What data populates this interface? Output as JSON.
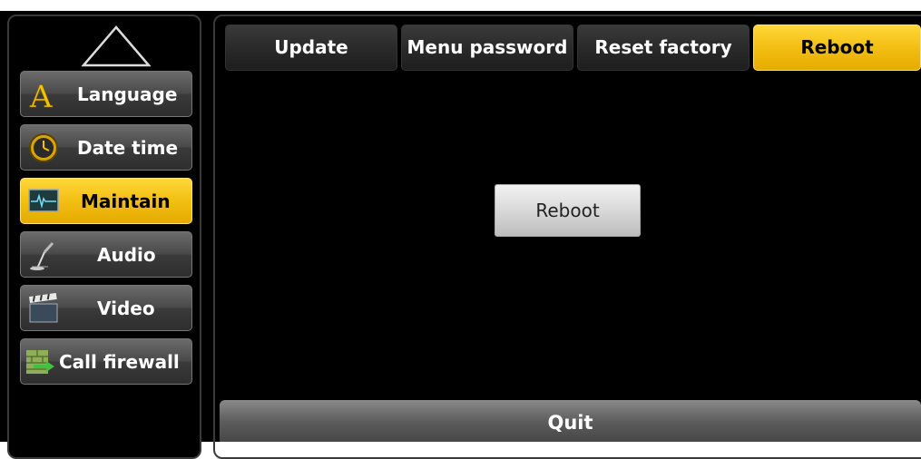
{
  "sidebar": {
    "items": [
      {
        "label": "Language",
        "icon": "letter-a-icon"
      },
      {
        "label": "Date time",
        "icon": "clock-icon"
      },
      {
        "label": "Maintain",
        "icon": "monitor-waveform-icon",
        "active": true
      },
      {
        "label": "Audio",
        "icon": "microphone-icon"
      },
      {
        "label": "Video",
        "icon": "clapperboard-icon"
      },
      {
        "label": "Call firewall",
        "icon": "firewall-icon"
      }
    ]
  },
  "tabs": [
    {
      "label": "Update"
    },
    {
      "label": "Menu password"
    },
    {
      "label": "Reset factory"
    },
    {
      "label": "Reboot",
      "active": true
    }
  ],
  "main": {
    "reboot_button": "Reboot"
  },
  "footer": {
    "quit_label": "Quit"
  },
  "colors": {
    "accent": "#f2bf12",
    "background": "#000000",
    "button_gray": "#4a4a4a"
  }
}
